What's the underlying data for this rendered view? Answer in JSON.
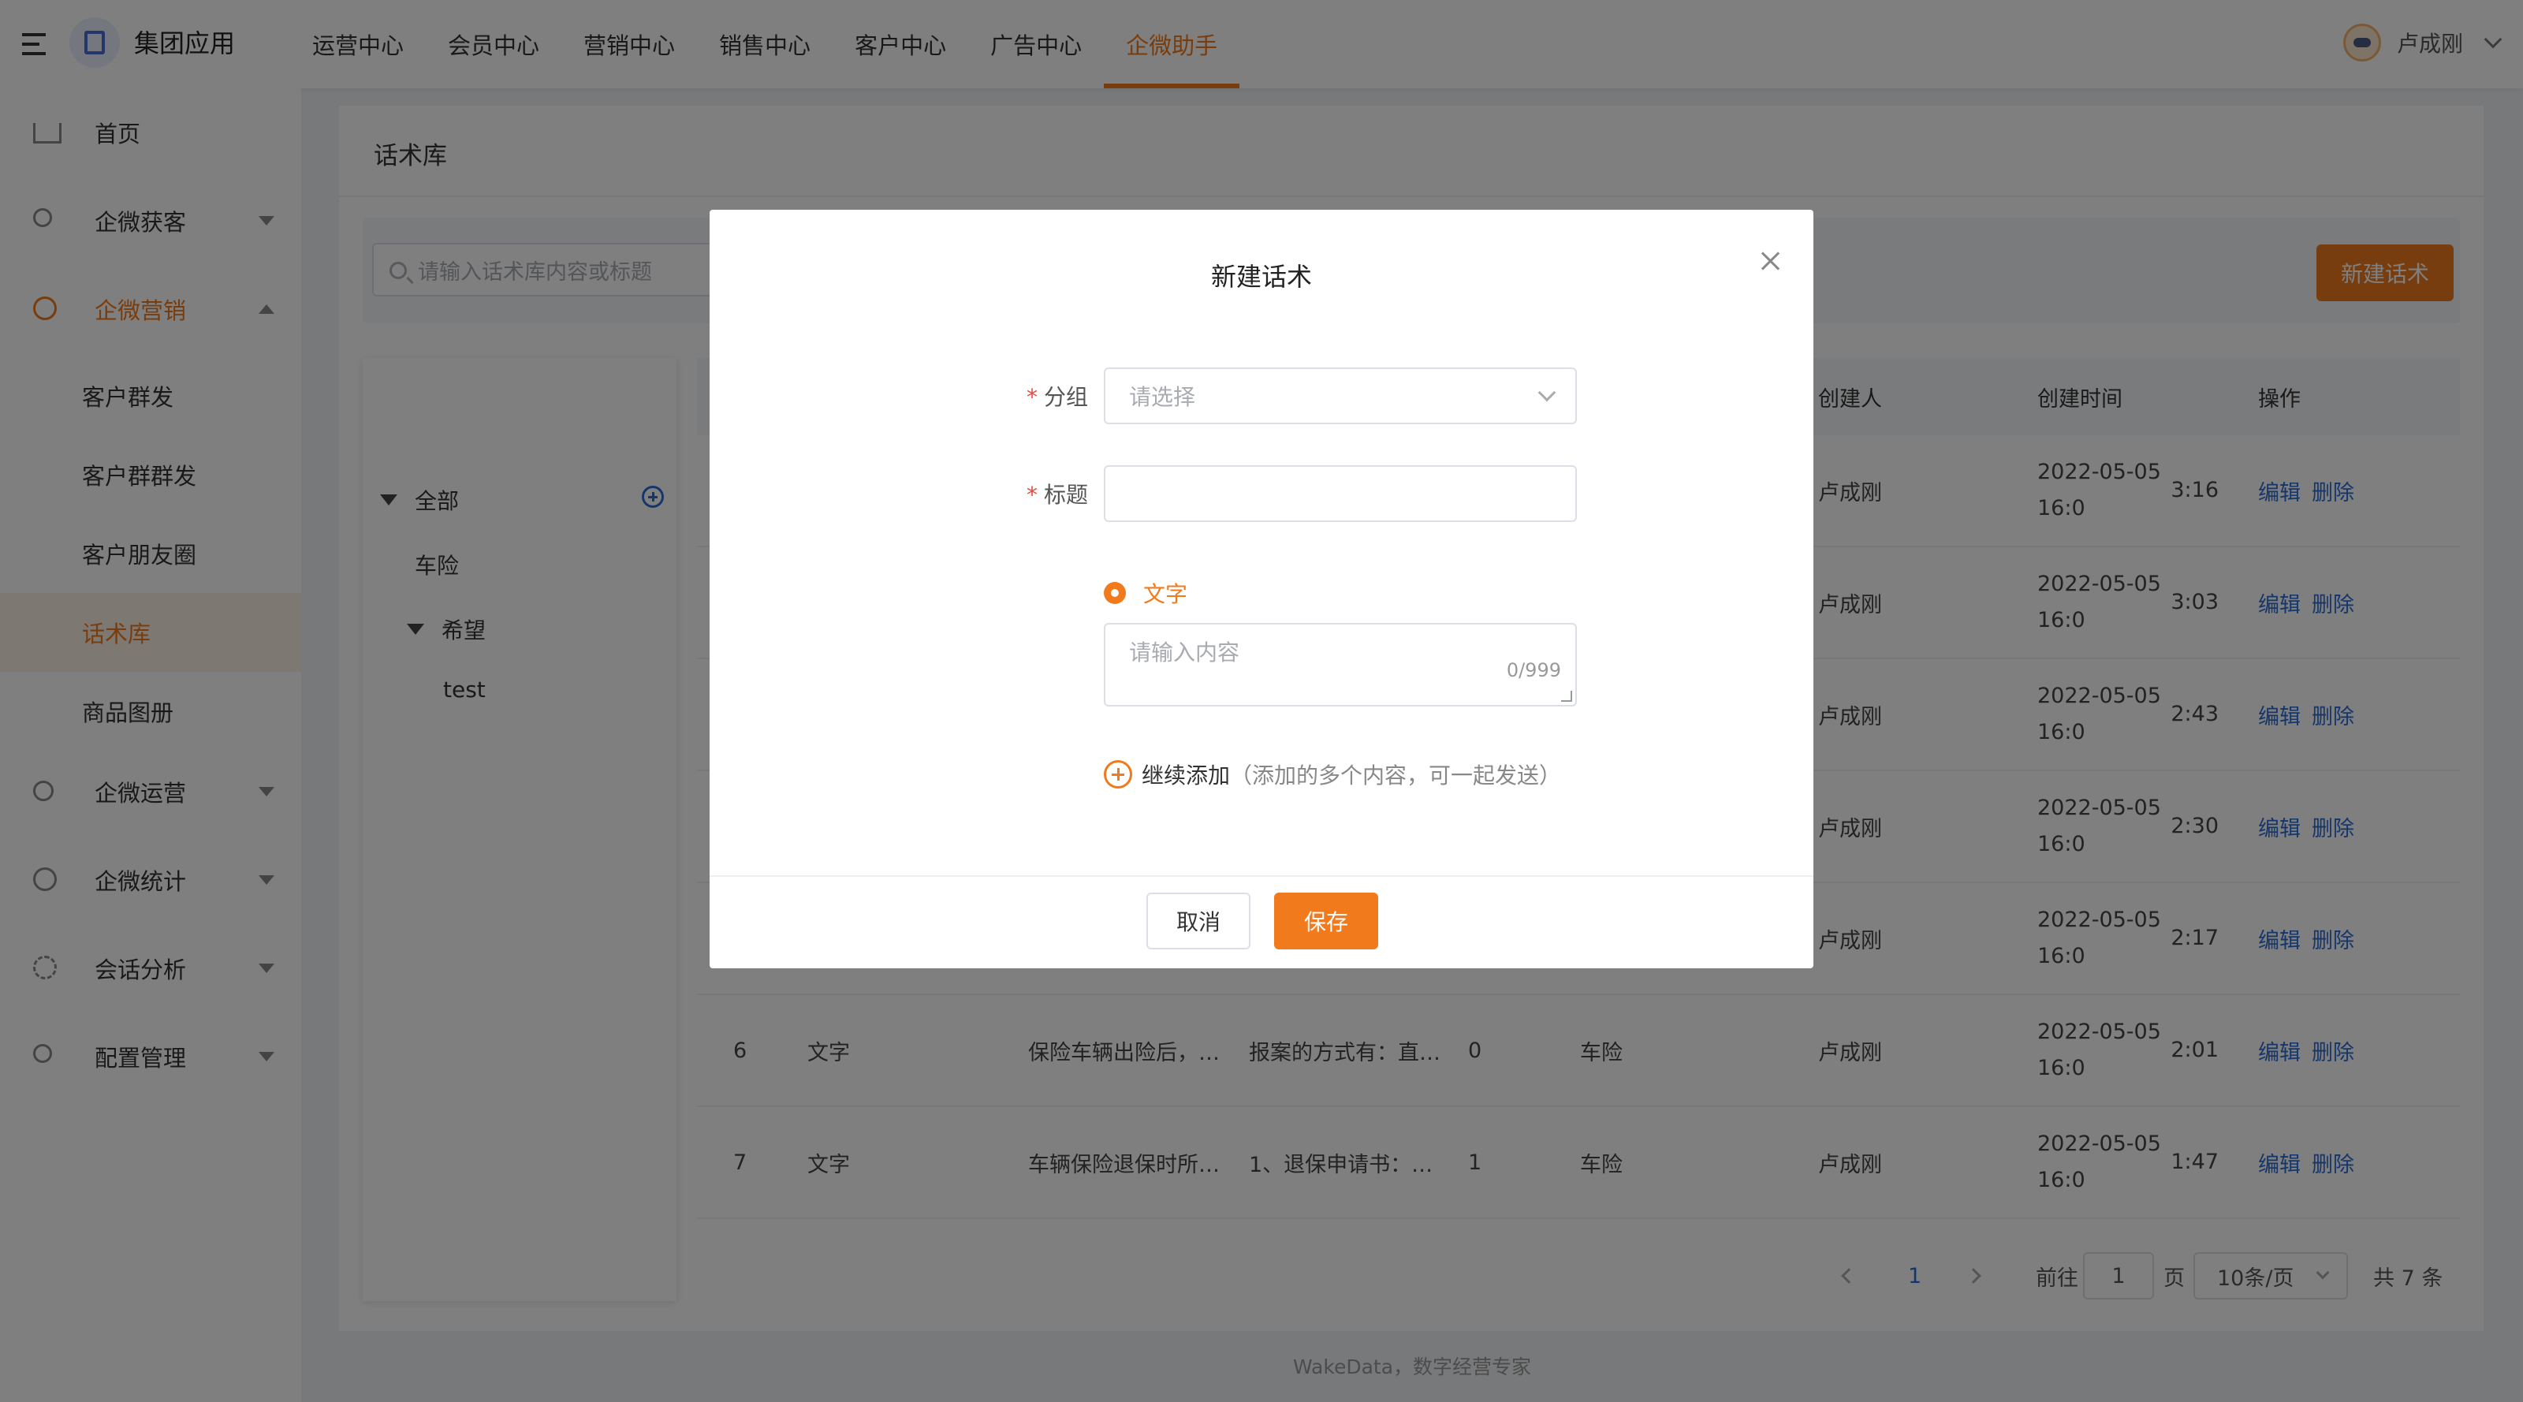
{
  "header": {
    "app_title": "集团应用",
    "nav": [
      "运营中心",
      "会员中心",
      "营销中心",
      "销售中心",
      "客户中心",
      "广告中心",
      "企微助手"
    ],
    "active_nav": "企微助手",
    "user_name": "卢成刚"
  },
  "sidebar": {
    "items": [
      {
        "label": "首页",
        "icon": "home-icon"
      },
      {
        "label": "企微获客",
        "icon": "user-add-icon"
      },
      {
        "label": "企微营销",
        "icon": "marketing-icon"
      },
      {
        "label": "企微运营",
        "icon": "users-icon"
      },
      {
        "label": "企微统计",
        "icon": "pie-chart-icon"
      },
      {
        "label": "会话分析",
        "icon": "gear-icon"
      },
      {
        "label": "配置管理",
        "icon": "user-settings-icon"
      }
    ],
    "sub_items": [
      "客户群发",
      "客户群群发",
      "客户朋友圈",
      "话术库",
      "商品图册"
    ],
    "active_sub": "话术库"
  },
  "page": {
    "title": "话术库",
    "search_placeholder": "请输入话术库内容或标题",
    "new_button": "新建话术"
  },
  "tree": {
    "root": "全部",
    "nodes": [
      "车险",
      "希望",
      "test"
    ]
  },
  "table": {
    "headers": {
      "creator": "创建人",
      "created_at": "创建时间",
      "actions": "操作"
    },
    "edit_label": "编辑",
    "delete_label": "删除",
    "rows": [
      {
        "no": "",
        "type": "",
        "title": "",
        "content": "",
        "count": "",
        "group": "",
        "creator": "卢成刚",
        "time1": "2022-05-05 16:0",
        "time2": "3:16"
      },
      {
        "no": "",
        "type": "",
        "title": "",
        "content": "",
        "count": "",
        "group": "",
        "creator": "卢成刚",
        "time1": "2022-05-05 16:0",
        "time2": "3:03"
      },
      {
        "no": "",
        "type": "",
        "title": "",
        "content": "",
        "count": "",
        "group": "",
        "creator": "卢成刚",
        "time1": "2022-05-05 16:0",
        "time2": "2:43"
      },
      {
        "no": "",
        "type": "",
        "title": "",
        "content": "",
        "count": "",
        "group": "",
        "creator": "卢成刚",
        "time1": "2022-05-05 16:0",
        "time2": "2:30"
      },
      {
        "no": "",
        "type": "",
        "title": "",
        "content": "",
        "count": "",
        "group": "",
        "creator": "卢成刚",
        "time1": "2022-05-05 16:0",
        "time2": "2:17"
      },
      {
        "no": "6",
        "type": "文字",
        "title": "保险车辆出险后，…",
        "content": "报案的方式有：直…",
        "count": "0",
        "group": "车险",
        "creator": "卢成刚",
        "time1": "2022-05-05 16:0",
        "time2": "2:01"
      },
      {
        "no": "7",
        "type": "文字",
        "title": "车辆保险退保时所…",
        "content": "1、退保申请书：…",
        "count": "1",
        "group": "车险",
        "creator": "卢成刚",
        "time1": "2022-05-05 16:0",
        "time2": "1:47"
      }
    ]
  },
  "pagination": {
    "current": "1",
    "goto_label": "前往",
    "goto_value": "1",
    "page_label": "页",
    "page_size": "10条/页",
    "total": "共 7 条"
  },
  "footer": "WakeData，数字经营专家",
  "modal": {
    "title": "新建话术",
    "group_label": "分组",
    "group_placeholder": "请选择",
    "title_label": "标题",
    "radio_label": "文字",
    "content_placeholder": "请输入内容",
    "char_count": "0/999",
    "add_more_label": "继续添加",
    "add_more_hint": "（添加的多个内容，可一起发送）",
    "cancel_label": "取消",
    "save_label": "保存"
  },
  "colors": {
    "accent": "#f07a1c",
    "link": "#2b6dd6",
    "required": "#e8483b"
  }
}
